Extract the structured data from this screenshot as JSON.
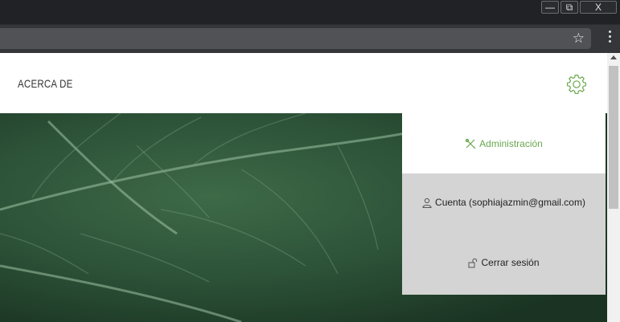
{
  "window": {
    "minimize_glyph": "—",
    "restore_glyph": "⧉",
    "close_glyph": "X"
  },
  "toolbar": {
    "bookmark_icon": "star-icon",
    "menu_icon": "kebab-menu-icon"
  },
  "header": {
    "nav_about": "ACERCA DE",
    "settings_icon": "gear-icon",
    "accent_color": "#6aa84f"
  },
  "menu": {
    "admin_label": "Administración",
    "admin_icon": "tools-icon",
    "account_label": "Cuenta (sophiajazmin@gmail.com)",
    "account_icon": "user-icon",
    "logout_label": "Cerrar sesión",
    "logout_icon": "unlock-icon",
    "panel_color": "#d3d4d3"
  }
}
